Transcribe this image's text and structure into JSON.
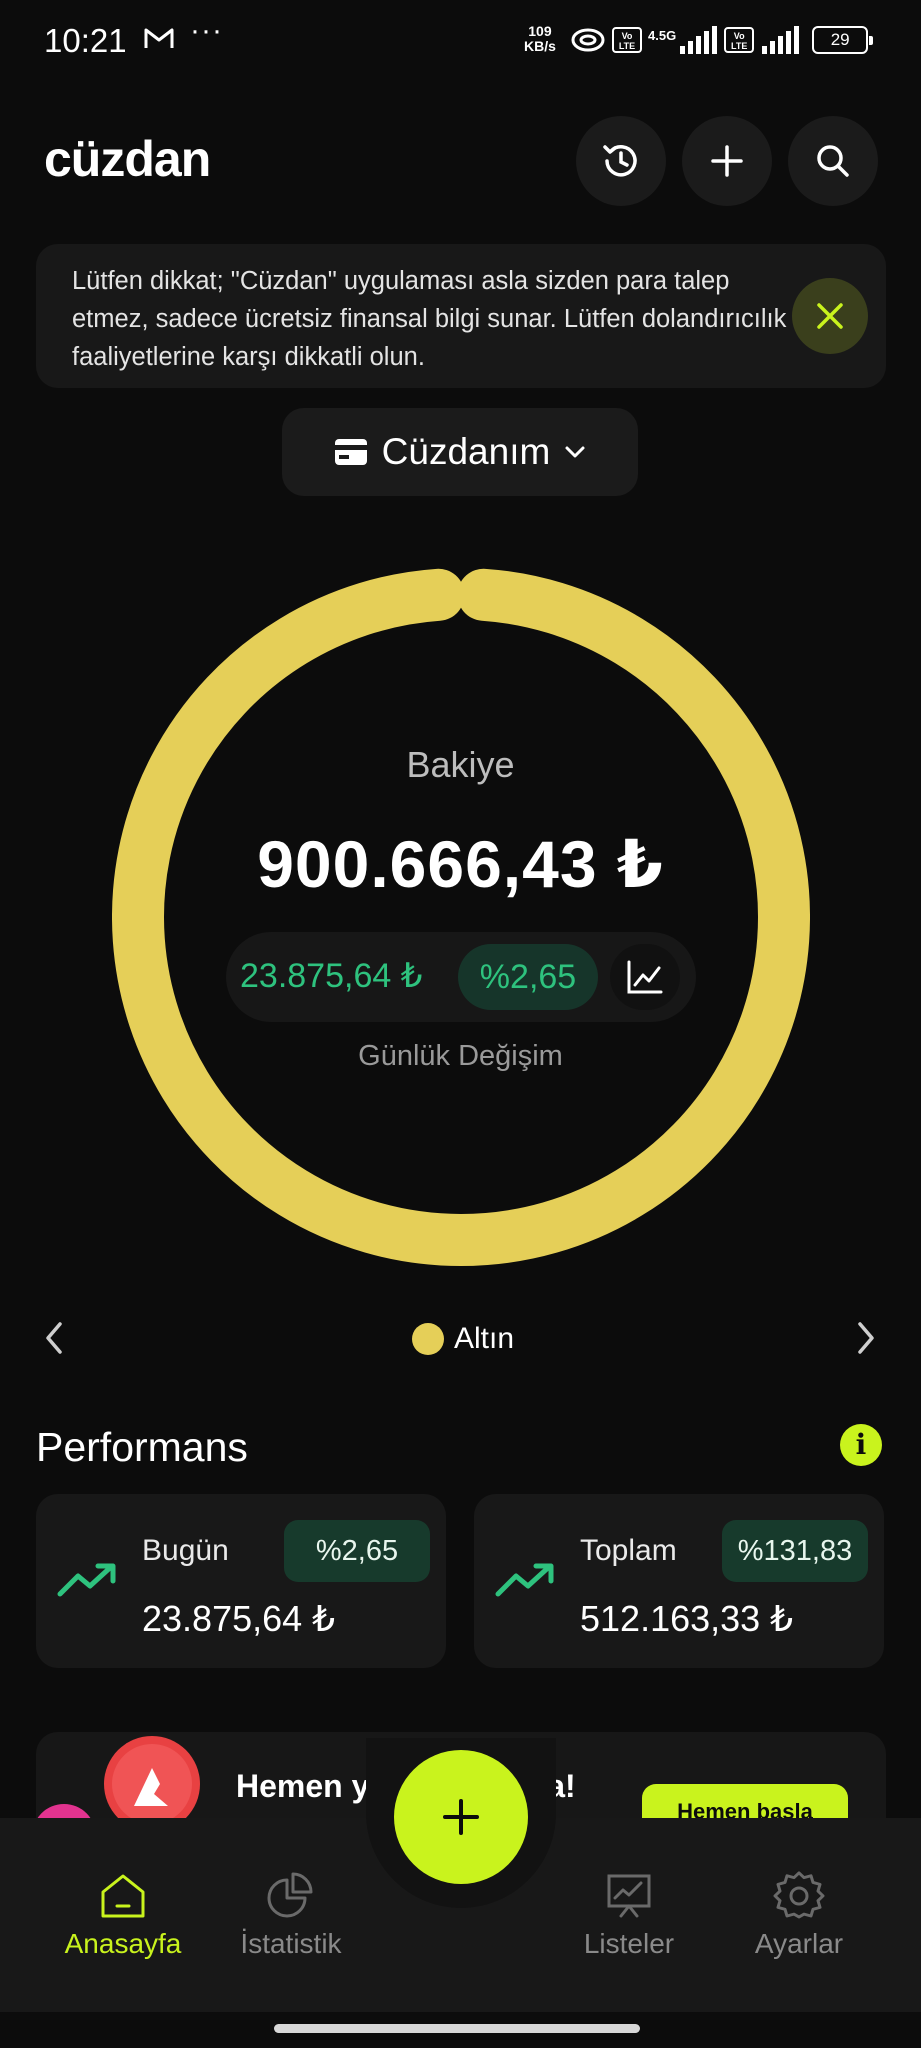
{
  "status_bar": {
    "time": "10:21",
    "more": "···",
    "speed_value": "109",
    "speed_unit": "KB/s",
    "lte1": "Vo LTE",
    "network": "4.5G",
    "lte2": "Vo LTE",
    "battery": "29"
  },
  "header": {
    "logo": "cüzdan",
    "icons": [
      "history-icon",
      "plus-icon",
      "search-icon"
    ]
  },
  "notice": {
    "text": "Lütfen dikkat; \"Cüzdan\" uygulaması asla sizden para talep etmez, sadece ücretsiz finansal bilgi sunar. Lütfen dolandırıcılık faaliyetlerine karşı dikkatli olun."
  },
  "wallet": {
    "name": "Cüzdanım"
  },
  "balance": {
    "label": "Bakiye",
    "value": "900.666,43 ₺",
    "change_amount": "23.875,64 ₺",
    "change_percent": "%2,65",
    "change_label": "Günlük Değişim"
  },
  "allocation": [
    {
      "name": "Altın",
      "share": 1.0,
      "color": "#e5cf58"
    }
  ],
  "category": {
    "current": "Altın"
  },
  "performance": {
    "title": "Performans",
    "today": {
      "label": "Bugün",
      "percent": "%2,65",
      "value": "23.875,64 ₺"
    },
    "total": {
      "label": "Toplam",
      "percent": "%131,83",
      "value": "512.163,33 ₺"
    }
  },
  "promo": {
    "text": "Hemen yatırıma başla!",
    "button": "Hemen başla"
  },
  "nav": {
    "home": "Anasayfa",
    "stats": "İstatistik",
    "lists": "Listeler",
    "settings": "Ayarlar"
  },
  "colors": {
    "accent": "#c9f31d",
    "gold": "#e5cf58",
    "positive": "#2ec27e",
    "background": "#0c0c0c"
  }
}
